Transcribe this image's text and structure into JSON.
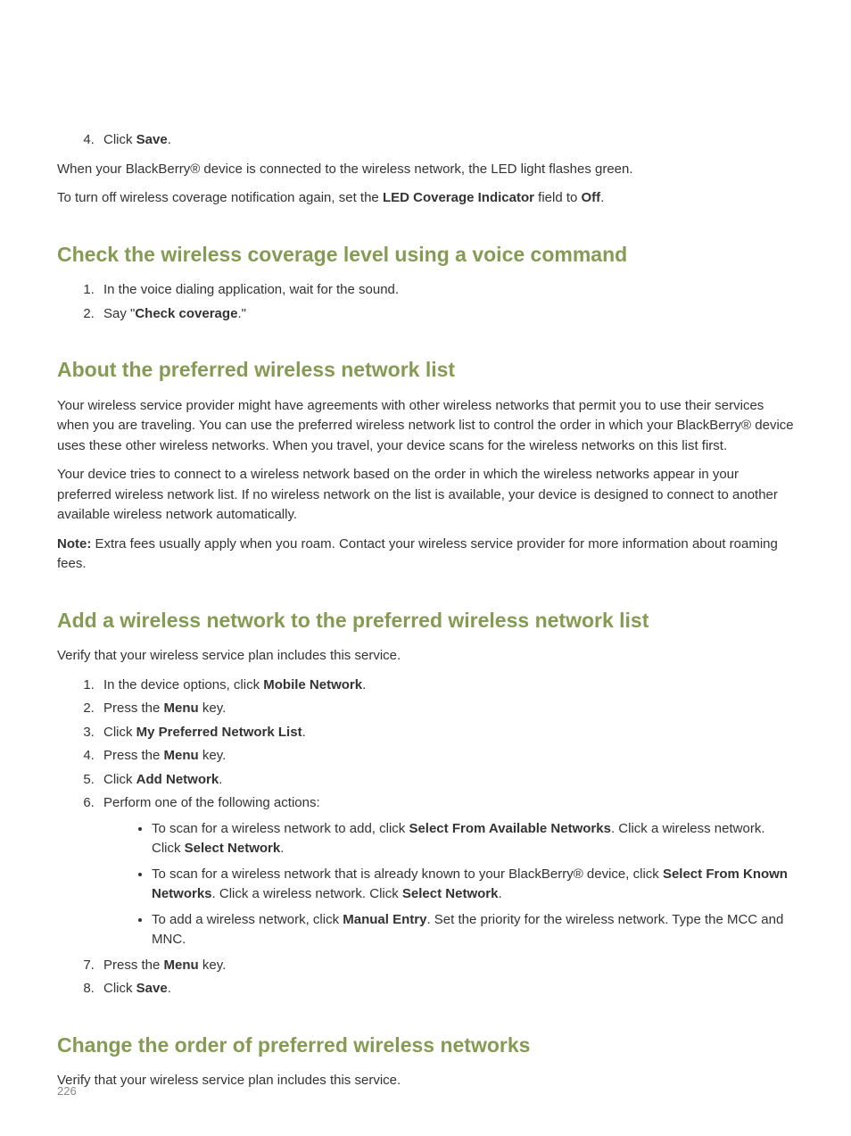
{
  "intro": {
    "step4": {
      "num": "4.",
      "pre": "Click ",
      "bold": "Save",
      "post": "."
    },
    "line1": "When your BlackBerry® device is connected to the wireless network, the LED light flashes green.",
    "line2_pre": "To turn off wireless coverage notification again, set the ",
    "line2_bold1": "LED Coverage Indicator",
    "line2_mid": " field to ",
    "line2_bold2": "Off",
    "line2_post": "."
  },
  "sec1": {
    "title": "Check the wireless coverage level using a voice command",
    "s1": {
      "num": "1.",
      "text": "In the voice dialing application, wait for the sound."
    },
    "s2": {
      "num": "2.",
      "pre": "Say \"",
      "bold": "Check coverage",
      "post": ".\""
    }
  },
  "sec2": {
    "title": "About the preferred wireless network list",
    "p1": "Your wireless service provider might have agreements with other wireless networks that permit you to use their services when you are traveling. You can use the preferred wireless network list to control the order in which your BlackBerry® device uses these other wireless networks. When you travel, your device scans for the wireless networks on this list first.",
    "p2": "Your device tries to connect to a wireless network based on the order in which the wireless networks appear in your preferred wireless network list. If no wireless network on the list is available, your device is designed to connect to another available wireless network automatically.",
    "p3_bold": "Note:",
    "p3_rest": "  Extra fees usually apply when you roam. Contact your wireless service provider for more information about roaming fees."
  },
  "sec3": {
    "title": "Add a wireless network to the preferred wireless network list",
    "intro": "Verify that your wireless service plan includes this service.",
    "s1": {
      "pre": "In the device options, click ",
      "bold": "Mobile Network",
      "post": "."
    },
    "s2": {
      "pre": "Press the ",
      "bold": "Menu",
      "post": " key."
    },
    "s3": {
      "pre": "Click ",
      "bold": "My Preferred Network List",
      "post": "."
    },
    "s4": {
      "pre": "Press the ",
      "bold": "Menu",
      "post": " key."
    },
    "s5": {
      "pre": "Click ",
      "bold": "Add Network",
      "post": "."
    },
    "s6": "Perform one of the following actions:",
    "b1": {
      "pre": "To scan for a wireless network to add, click ",
      "b1": "Select From Available Networks",
      "mid": ". Click a wireless network. Click ",
      "b2": "Select Network",
      "post": "."
    },
    "b2": {
      "pre": "To scan for a wireless network that is already known to your BlackBerry® device, click ",
      "b1": "Select From Known Networks",
      "mid": ". Click a wireless network. Click ",
      "b2": "Select Network",
      "post": "."
    },
    "b3": {
      "pre": "To add a wireless network, click ",
      "b1": "Manual Entry",
      "post": ". Set the priority for the wireless network. Type the MCC and MNC."
    },
    "s7": {
      "pre": "Press the ",
      "bold": "Menu",
      "post": " key."
    },
    "s8": {
      "pre": "Click ",
      "bold": "Save",
      "post": "."
    }
  },
  "sec4": {
    "title": "Change the order of preferred wireless networks",
    "intro": "Verify that your wireless service plan includes this service."
  },
  "page_number": "226"
}
